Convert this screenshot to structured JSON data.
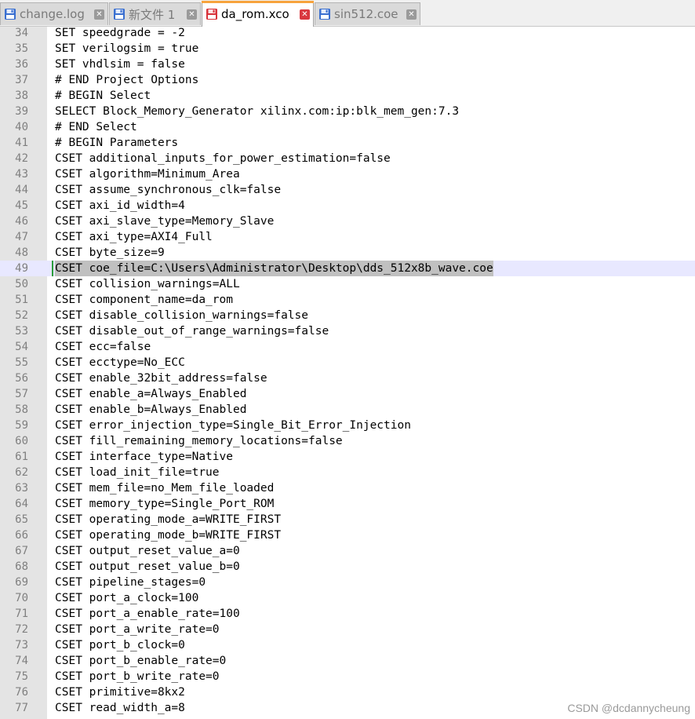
{
  "tabs": [
    {
      "label": "change.log",
      "state": "inactive",
      "icon": "floppy-disk-icon"
    },
    {
      "label": "新文件 1",
      "state": "inactive",
      "icon": "floppy-disk-icon"
    },
    {
      "label": "da_rom.xco",
      "state": "active",
      "icon": "floppy-disk-red-icon"
    },
    {
      "label": "sin512.coe",
      "state": "inactive",
      "icon": "floppy-disk-icon"
    }
  ],
  "close_glyph": "✕",
  "current_line": 49,
  "lines": [
    {
      "n": "34",
      "text": "SET speedgrade = -2"
    },
    {
      "n": "35",
      "text": "SET verilogsim = true"
    },
    {
      "n": "36",
      "text": "SET vhdlsim = false"
    },
    {
      "n": "37",
      "text": "# END Project Options"
    },
    {
      "n": "38",
      "text": "# BEGIN Select"
    },
    {
      "n": "39",
      "text": "SELECT Block_Memory_Generator xilinx.com:ip:blk_mem_gen:7.3"
    },
    {
      "n": "40",
      "text": "# END Select"
    },
    {
      "n": "41",
      "text": "# BEGIN Parameters"
    },
    {
      "n": "42",
      "text": "CSET additional_inputs_for_power_estimation=false"
    },
    {
      "n": "43",
      "text": "CSET algorithm=Minimum_Area"
    },
    {
      "n": "44",
      "text": "CSET assume_synchronous_clk=false"
    },
    {
      "n": "45",
      "text": "CSET axi_id_width=4"
    },
    {
      "n": "46",
      "text": "CSET axi_slave_type=Memory_Slave"
    },
    {
      "n": "47",
      "text": "CSET axi_type=AXI4_Full"
    },
    {
      "n": "48",
      "text": "CSET byte_size=9"
    },
    {
      "n": "49",
      "text": "CSET coe_file=C:\\Users\\Administrator\\Desktop\\dds_512x8b_wave.coe"
    },
    {
      "n": "50",
      "text": "CSET collision_warnings=ALL"
    },
    {
      "n": "51",
      "text": "CSET component_name=da_rom"
    },
    {
      "n": "52",
      "text": "CSET disable_collision_warnings=false"
    },
    {
      "n": "53",
      "text": "CSET disable_out_of_range_warnings=false"
    },
    {
      "n": "54",
      "text": "CSET ecc=false"
    },
    {
      "n": "55",
      "text": "CSET ecctype=No_ECC"
    },
    {
      "n": "56",
      "text": "CSET enable_32bit_address=false"
    },
    {
      "n": "57",
      "text": "CSET enable_a=Always_Enabled"
    },
    {
      "n": "58",
      "text": "CSET enable_b=Always_Enabled"
    },
    {
      "n": "59",
      "text": "CSET error_injection_type=Single_Bit_Error_Injection"
    },
    {
      "n": "60",
      "text": "CSET fill_remaining_memory_locations=false"
    },
    {
      "n": "61",
      "text": "CSET interface_type=Native"
    },
    {
      "n": "62",
      "text": "CSET load_init_file=true"
    },
    {
      "n": "63",
      "text": "CSET mem_file=no_Mem_file_loaded"
    },
    {
      "n": "64",
      "text": "CSET memory_type=Single_Port_ROM"
    },
    {
      "n": "65",
      "text": "CSET operating_mode_a=WRITE_FIRST"
    },
    {
      "n": "66",
      "text": "CSET operating_mode_b=WRITE_FIRST"
    },
    {
      "n": "67",
      "text": "CSET output_reset_value_a=0"
    },
    {
      "n": "68",
      "text": "CSET output_reset_value_b=0"
    },
    {
      "n": "69",
      "text": "CSET pipeline_stages=0"
    },
    {
      "n": "70",
      "text": "CSET port_a_clock=100"
    },
    {
      "n": "71",
      "text": "CSET port_a_enable_rate=100"
    },
    {
      "n": "72",
      "text": "CSET port_a_write_rate=0"
    },
    {
      "n": "73",
      "text": "CSET port_b_clock=0"
    },
    {
      "n": "74",
      "text": "CSET port_b_enable_rate=0"
    },
    {
      "n": "75",
      "text": "CSET port_b_write_rate=0"
    },
    {
      "n": "76",
      "text": "CSET primitive=8kx2"
    },
    {
      "n": "77",
      "text": "CSET read_width_a=8"
    }
  ],
  "watermark": "CSDN @dcdannycheung",
  "colors": {
    "active_tab_accent": "#f7a33c",
    "close_active": "#d9383f",
    "close_inactive": "#9a9a9a",
    "current_line_bg": "#e8e8ff",
    "selection_bg": "#c0c0c0",
    "caret_marker": "#2a9d3a",
    "gutter_bg": "#e4e4e4"
  }
}
